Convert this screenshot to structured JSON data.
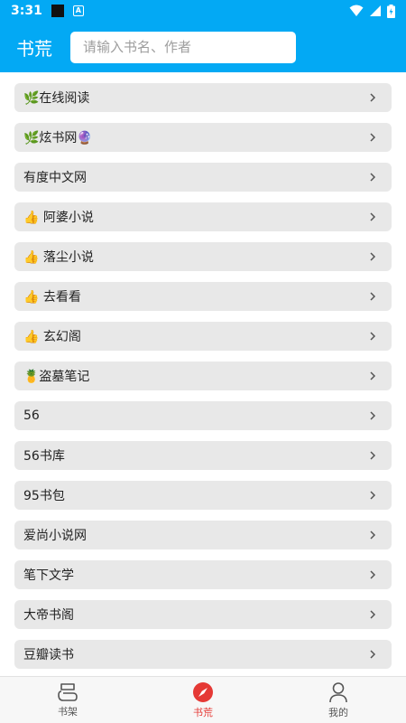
{
  "status": {
    "time": "3:31"
  },
  "header": {
    "title": "书荒",
    "search_placeholder": "请输入书名、作者"
  },
  "sources": [
    {
      "label": "🌿在线阅读"
    },
    {
      "label": "🌿炫书网🔮"
    },
    {
      "label": "有度中文网"
    },
    {
      "label": "👍 阿婆小说"
    },
    {
      "label": "👍 落尘小说"
    },
    {
      "label": "👍 去看看"
    },
    {
      "label": "👍 玄幻阁"
    },
    {
      "label": "🍍盗墓笔记"
    },
    {
      "label": "56"
    },
    {
      "label": "56书库"
    },
    {
      "label": "95书包"
    },
    {
      "label": "爱尚小说网"
    },
    {
      "label": "笔下文学"
    },
    {
      "label": "大帝书阁"
    },
    {
      "label": "豆瓣读书"
    }
  ],
  "nav": {
    "bookshelf": "书架",
    "bookhunt": "书荒",
    "mine": "我的"
  },
  "colors": {
    "primary": "#03a9f4",
    "active": "#e53935"
  }
}
